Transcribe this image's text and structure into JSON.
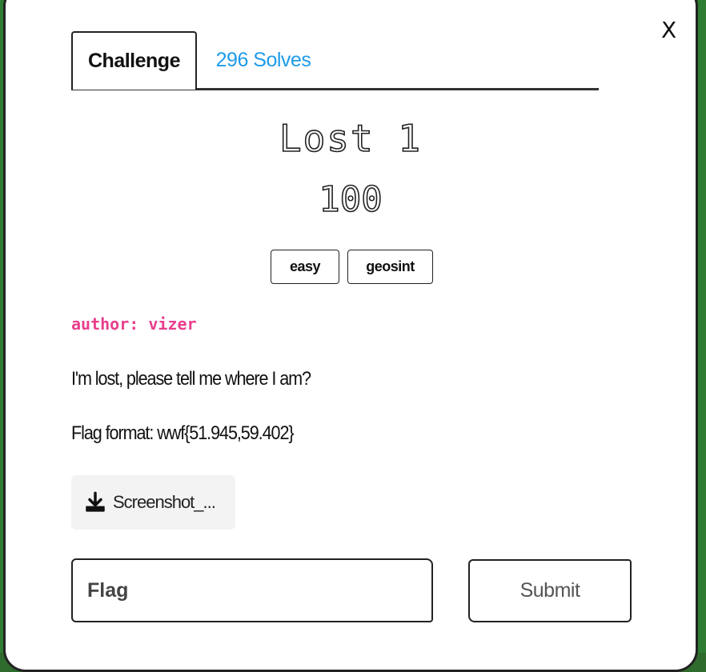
{
  "modal": {
    "close_label": "X",
    "tabs": [
      {
        "label": "Challenge",
        "active": true
      },
      {
        "label": "296 Solves",
        "active": false
      }
    ],
    "title": "Lost 1",
    "points": "100",
    "tags": [
      "easy",
      "geosint"
    ],
    "author": "author: vizer",
    "description": [
      "I'm lost, please tell me where I am?",
      "Flag format: wwf{51.945,59.402}"
    ],
    "file": {
      "label": "Screenshot_...",
      "icon": "download-icon"
    },
    "flag_input": {
      "placeholder": "Flag",
      "value": ""
    },
    "submit_label": "Submit"
  },
  "colors": {
    "solves_link": "#1e9be9",
    "author": "#e83e8c",
    "background": "#2e7d32"
  }
}
